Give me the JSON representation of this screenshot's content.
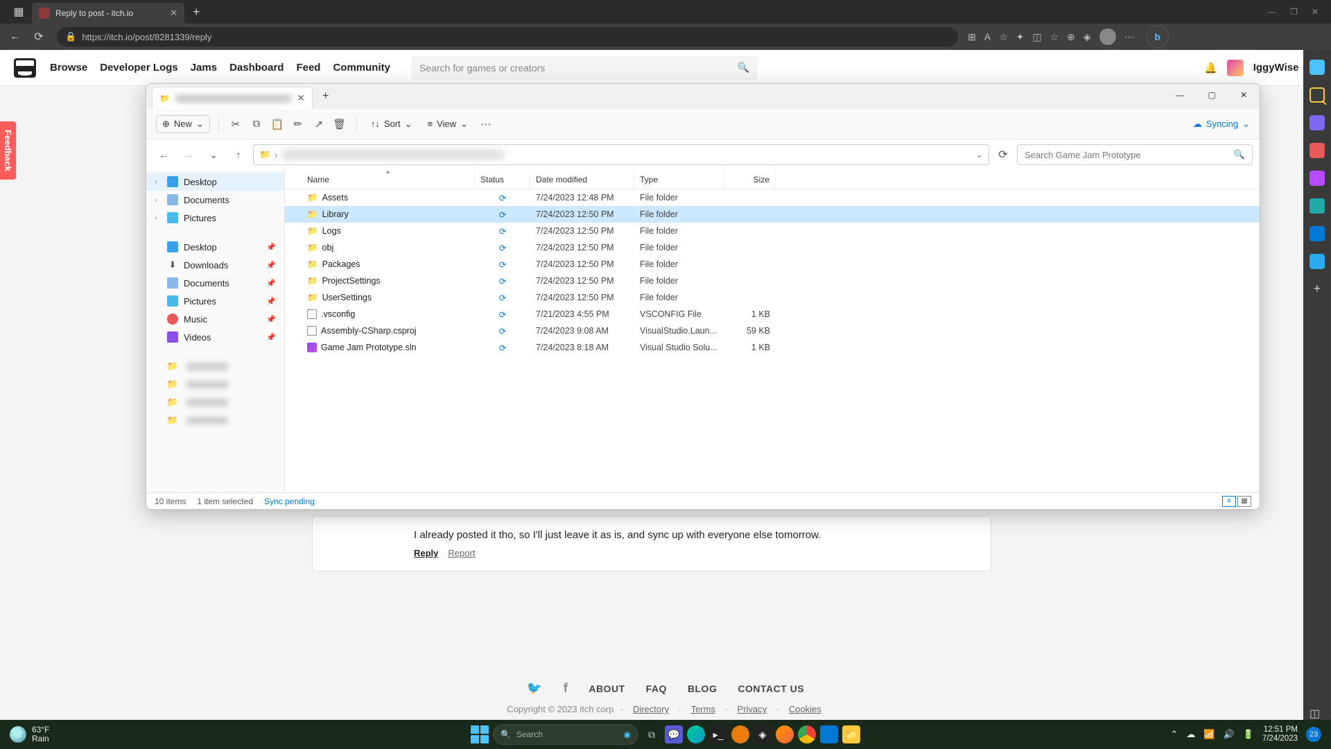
{
  "browser": {
    "tab_title": "Reply to post - itch.io",
    "url": "https://itch.io/post/8281339/reply",
    "lock_icon": "lock-icon",
    "window_controls": {
      "min": "—",
      "max": "❐",
      "close": "✕"
    }
  },
  "itch": {
    "nav": [
      "Browse",
      "Developer Logs",
      "Jams",
      "Dashboard",
      "Feed",
      "Community"
    ],
    "search_placeholder": "Search for games or creators",
    "username": "IggyWise"
  },
  "feedback_tab": "Feedback",
  "post": {
    "text": "I already posted it tho, so I'll just leave it as is, and sync up with everyone else tomorrow.",
    "reply": "Reply",
    "report": "Report"
  },
  "footer": {
    "links": [
      "ABOUT",
      "FAQ",
      "BLOG",
      "CONTACT US"
    ],
    "copyright": "Copyright © 2023 itch corp",
    "sublinks": [
      "Directory",
      "Terms",
      "Privacy",
      "Cookies"
    ]
  },
  "explorer": {
    "toolbar": {
      "new": "New",
      "sort": "Sort",
      "view": "View",
      "syncing": "Syncing"
    },
    "addr": {
      "search_placeholder": "Search Game Jam Prototype"
    },
    "sidebar": {
      "quick": [
        {
          "label": "Desktop",
          "icon": "desktop",
          "chev": true,
          "selected": true
        },
        {
          "label": "Documents",
          "icon": "doc",
          "chev": true
        },
        {
          "label": "Pictures",
          "icon": "pic",
          "chev": true
        }
      ],
      "pinned": [
        {
          "label": "Desktop",
          "icon": "desktop"
        },
        {
          "label": "Downloads",
          "icon": "dl"
        },
        {
          "label": "Documents",
          "icon": "doc"
        },
        {
          "label": "Pictures",
          "icon": "pic"
        },
        {
          "label": "Music",
          "icon": "music"
        },
        {
          "label": "Videos",
          "icon": "video"
        }
      ]
    },
    "columns": {
      "name": "Name",
      "status": "Status",
      "date": "Date modified",
      "type": "Type",
      "size": "Size"
    },
    "files": [
      {
        "name": "Assets",
        "icon": "folder",
        "status": "sync",
        "date": "7/24/2023 12:48 PM",
        "type": "File folder",
        "size": ""
      },
      {
        "name": "Library",
        "icon": "folder",
        "status": "sync",
        "date": "7/24/2023 12:50 PM",
        "type": "File folder",
        "size": "",
        "selected": true
      },
      {
        "name": "Logs",
        "icon": "folder",
        "status": "sync",
        "date": "7/24/2023 12:50 PM",
        "type": "File folder",
        "size": ""
      },
      {
        "name": "obj",
        "icon": "folder",
        "status": "sync",
        "date": "7/24/2023 12:50 PM",
        "type": "File folder",
        "size": ""
      },
      {
        "name": "Packages",
        "icon": "folder",
        "status": "sync",
        "date": "7/24/2023 12:50 PM",
        "type": "File folder",
        "size": ""
      },
      {
        "name": "ProjectSettings",
        "icon": "folder",
        "status": "sync",
        "date": "7/24/2023 12:50 PM",
        "type": "File folder",
        "size": ""
      },
      {
        "name": "UserSettings",
        "icon": "folder",
        "status": "sync",
        "date": "7/24/2023 12:50 PM",
        "type": "File folder",
        "size": ""
      },
      {
        "name": ".vsconfig",
        "icon": "file",
        "status": "sync",
        "date": "7/21/2023 4:55 PM",
        "type": "VSCONFIG File",
        "size": "1 KB"
      },
      {
        "name": "Assembly-CSharp.csproj",
        "icon": "file",
        "status": "sync",
        "date": "7/24/2023 9:08 AM",
        "type": "VisualStudio.Laun...",
        "size": "59 KB"
      },
      {
        "name": "Game Jam Prototype.sln",
        "icon": "sln",
        "status": "sync",
        "date": "7/24/2023 8:18 AM",
        "type": "Visual Studio Solu...",
        "size": "1 KB"
      }
    ],
    "status": {
      "items": "10 items",
      "selected": "1 item selected",
      "sync": "Sync pending"
    }
  },
  "taskbar": {
    "weather": {
      "temp": "63°F",
      "cond": "Rain"
    },
    "search_placeholder": "Search",
    "clock": {
      "time": "12:51 PM",
      "date": "7/24/2023"
    },
    "notif_count": "23"
  }
}
